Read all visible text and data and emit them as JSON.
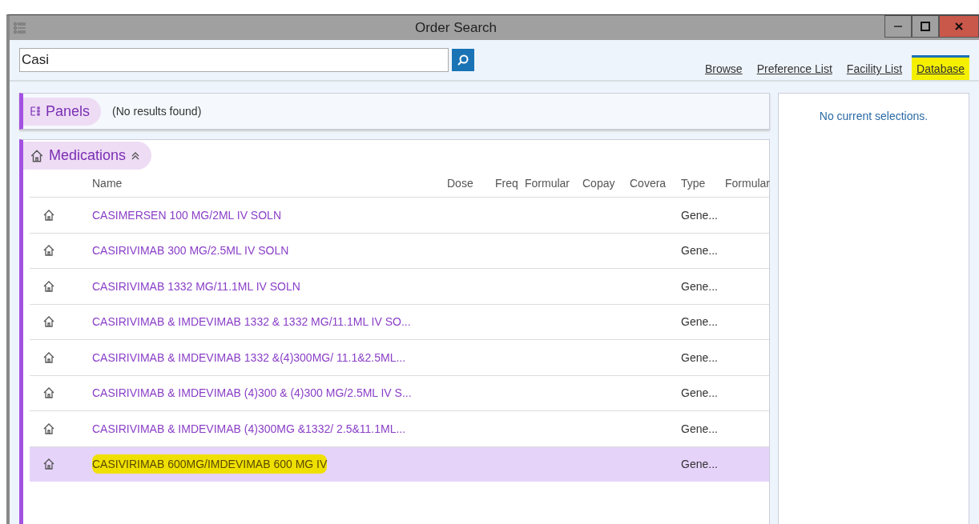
{
  "window": {
    "title": "Order Search"
  },
  "search": {
    "value": "Casi"
  },
  "tabs": [
    {
      "label": "Browse",
      "selected": false,
      "highlighted": false
    },
    {
      "label": "Preference List",
      "selected": false,
      "highlighted": false
    },
    {
      "label": "Facility List",
      "selected": false,
      "highlighted": false
    },
    {
      "label": "Database",
      "selected": true,
      "highlighted": true
    }
  ],
  "panels": {
    "title": "Panels",
    "message": "(No results found)"
  },
  "medications": {
    "title": "Medications",
    "expanded": true,
    "columns": [
      "Name",
      "Dose",
      "Freq",
      "Formular",
      "Copay",
      "Covera",
      "Type",
      "Formular"
    ],
    "rows": [
      {
        "name": "CASIMERSEN 100 MG/2ML IV SOLN",
        "type": "Gene...",
        "selected": false,
        "highlighted": false
      },
      {
        "name": "CASIRIVIMAB 300 MG/2.5ML IV SOLN",
        "type": "Gene...",
        "selected": false,
        "highlighted": false
      },
      {
        "name": "CASIRIVIMAB 1332 MG/11.1ML IV SOLN",
        "type": "Gene...",
        "selected": false,
        "highlighted": false
      },
      {
        "name": "CASIRIVIMAB & IMDEVIMAB 1332 & 1332 MG/11.1ML IV SO...",
        "type": "Gene...",
        "selected": false,
        "highlighted": false
      },
      {
        "name": "CASIRIVIMAB & IMDEVIMAB 1332 &(4)300MG/ 11.1&2.5ML...",
        "type": "Gene...",
        "selected": false,
        "highlighted": false
      },
      {
        "name": "CASIRIVIMAB & IMDEVIMAB (4)300 & (4)300 MG/2.5ML IV S...",
        "type": "Gene...",
        "selected": false,
        "highlighted": false
      },
      {
        "name": "CASIRIVIMAB & IMDEVIMAB (4)300MG &1332/ 2.5&11.1ML...",
        "type": "Gene...",
        "selected": false,
        "highlighted": false
      },
      {
        "name": "CASIVIRIMAB 600MG/IMDEVIMAB 600 MG IV",
        "type": "Gene...",
        "selected": true,
        "highlighted": true
      }
    ]
  },
  "selections": {
    "message": "No current selections."
  }
}
